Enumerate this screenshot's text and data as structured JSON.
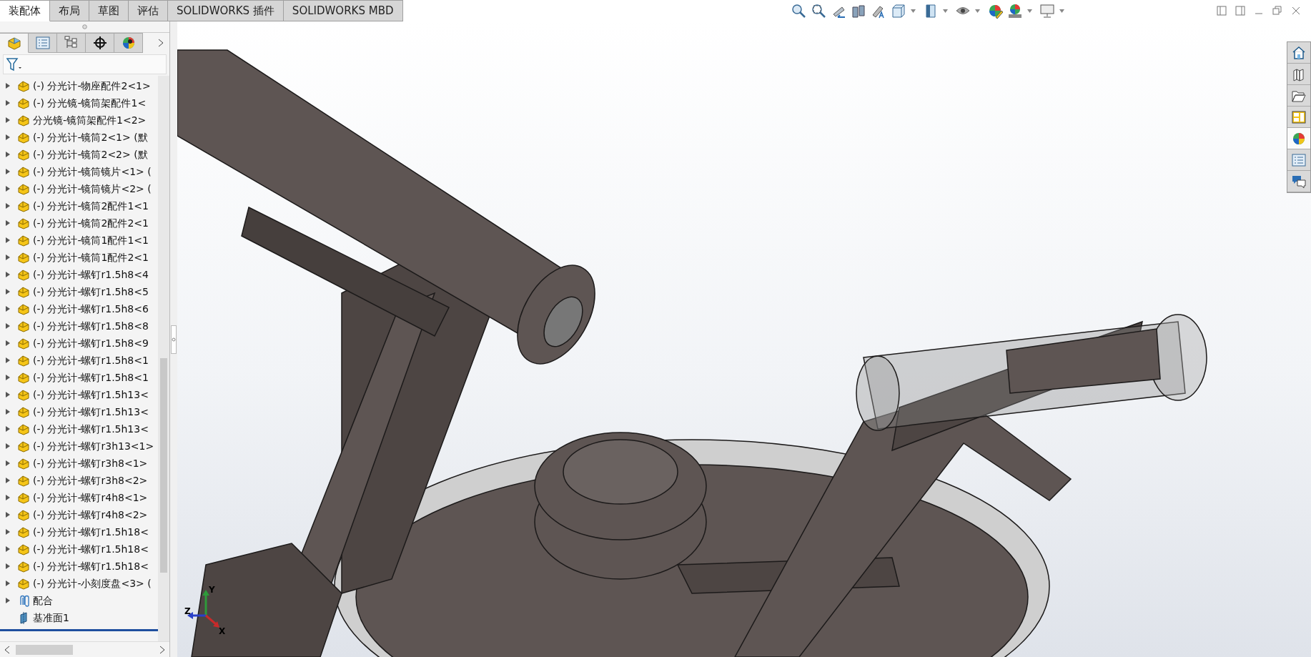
{
  "tabs": [
    {
      "label": "装配体",
      "selected": true
    },
    {
      "label": "布局",
      "selected": false
    },
    {
      "label": "草图",
      "selected": false
    },
    {
      "label": "评估",
      "selected": false
    },
    {
      "label": "SOLIDWORKS 插件",
      "selected": false
    },
    {
      "label": "SOLIDWORKS MBD",
      "selected": false
    }
  ],
  "panel_tabs": [
    {
      "selected": true
    },
    {
      "selected": false
    },
    {
      "selected": false
    },
    {
      "selected": false
    },
    {
      "selected": false
    }
  ],
  "tree": [
    {
      "kind": "component",
      "label": "(-) 分光计-物座配件2<1>",
      "expandable": true
    },
    {
      "kind": "component",
      "label": "(-) 分光镜-镜筒架配件1<",
      "expandable": true
    },
    {
      "kind": "component",
      "label": "分光镜-镜筒架配件1<2>",
      "expandable": true
    },
    {
      "kind": "component",
      "label": "(-) 分光计-镜筒2<1> (默",
      "expandable": true
    },
    {
      "kind": "component",
      "label": "(-) 分光计-镜筒2<2> (默",
      "expandable": true
    },
    {
      "kind": "component",
      "label": "(-) 分光计-镜筒镜片<1> (",
      "expandable": true
    },
    {
      "kind": "component",
      "label": "(-) 分光计-镜筒镜片<2> (",
      "expandable": true
    },
    {
      "kind": "component",
      "label": "(-) 分光计-镜筒2配件1<1",
      "expandable": true
    },
    {
      "kind": "component",
      "label": "(-) 分光计-镜筒2配件2<1",
      "expandable": true
    },
    {
      "kind": "component",
      "label": "(-) 分光计-镜筒1配件1<1",
      "expandable": true
    },
    {
      "kind": "component",
      "label": "(-) 分光计-镜筒1配件2<1",
      "expandable": true
    },
    {
      "kind": "component",
      "label": "(-) 分光计-螺钉r1.5h8<4",
      "expandable": true
    },
    {
      "kind": "component",
      "label": "(-) 分光计-螺钉r1.5h8<5",
      "expandable": true
    },
    {
      "kind": "component",
      "label": "(-) 分光计-螺钉r1.5h8<6",
      "expandable": true
    },
    {
      "kind": "component",
      "label": "(-) 分光计-螺钉r1.5h8<8",
      "expandable": true
    },
    {
      "kind": "component",
      "label": "(-) 分光计-螺钉r1.5h8<9",
      "expandable": true
    },
    {
      "kind": "component",
      "label": "(-) 分光计-螺钉r1.5h8<1",
      "expandable": true
    },
    {
      "kind": "component",
      "label": "(-) 分光计-螺钉r1.5h8<1",
      "expandable": true
    },
    {
      "kind": "component",
      "label": "(-) 分光计-螺钉r1.5h13<",
      "expandable": true
    },
    {
      "kind": "component",
      "label": "(-) 分光计-螺钉r1.5h13<",
      "expandable": true
    },
    {
      "kind": "component",
      "label": "(-) 分光计-螺钉r1.5h13<",
      "expandable": true
    },
    {
      "kind": "component",
      "label": "(-) 分光计-螺钉r3h13<1>",
      "expandable": true
    },
    {
      "kind": "component",
      "label": "(-) 分光计-螺钉r3h8<1>",
      "expandable": true
    },
    {
      "kind": "component",
      "label": "(-) 分光计-螺钉r3h8<2>",
      "expandable": true
    },
    {
      "kind": "component",
      "label": "(-) 分光计-螺钉r4h8<1>",
      "expandable": true
    },
    {
      "kind": "component",
      "label": "(-) 分光计-螺钉r4h8<2>",
      "expandable": true
    },
    {
      "kind": "component",
      "label": "(-) 分光计-螺钉r1.5h18<",
      "expandable": true
    },
    {
      "kind": "component",
      "label": "(-) 分光计-螺钉r1.5h18<",
      "expandable": true
    },
    {
      "kind": "component",
      "label": "(-) 分光计-螺钉r1.5h18<",
      "expandable": true
    },
    {
      "kind": "component",
      "label": "(-) 分光计-小刻度盘<3> (",
      "expandable": true
    },
    {
      "kind": "mates",
      "label": "配合",
      "expandable": true
    },
    {
      "kind": "plane",
      "label": "基准面1",
      "expandable": false
    }
  ],
  "task_pane": [
    {
      "selected": false
    },
    {
      "selected": false
    },
    {
      "selected": false
    },
    {
      "selected": false
    },
    {
      "selected": true
    },
    {
      "selected": false
    },
    {
      "selected": false
    }
  ],
  "triad": {
    "x": "X",
    "y": "Y",
    "z": "Z"
  }
}
